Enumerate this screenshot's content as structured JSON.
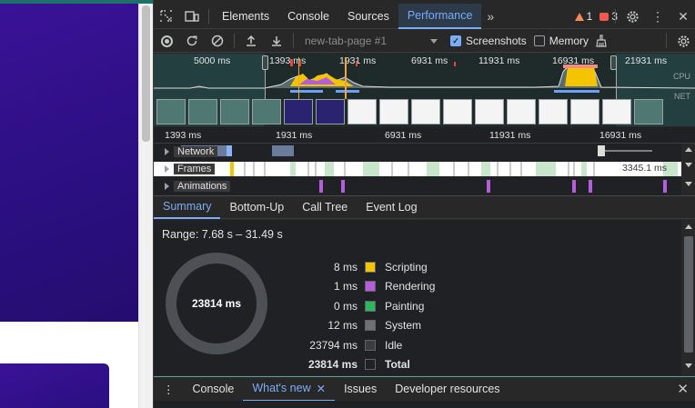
{
  "tabs": {
    "items": [
      "Elements",
      "Console",
      "Sources",
      "Performance"
    ],
    "active": "Performance",
    "warnings_count": "1",
    "errors_count": "3"
  },
  "toolbar": {
    "profile_name": "new-tab-page #1",
    "screenshots_label": "Screenshots",
    "screenshots_checked": true,
    "memory_label": "Memory",
    "memory_checked": false
  },
  "overview": {
    "ticks": [
      "5000 ms",
      "1393 ms",
      "1931 ms",
      "6931 ms",
      "11931 ms",
      "16931 ms",
      "21931 ms"
    ],
    "cpu_label": "CPU",
    "net_label": "NET"
  },
  "timeline": {
    "ticks": [
      "1393 ms",
      "1931 ms",
      "6931 ms",
      "11931 ms",
      "16931 ms"
    ],
    "tracks": [
      {
        "label": "Network"
      },
      {
        "label": "Frames",
        "value": "3345.1 ms"
      },
      {
        "label": "Animations"
      }
    ]
  },
  "bottom_tabs": {
    "items": [
      "Summary",
      "Bottom-Up",
      "Call Tree",
      "Event Log"
    ],
    "active": "Summary"
  },
  "summary": {
    "range": "Range: 7.68 s – 31.49 s",
    "total_ms": "23814 ms",
    "rows": [
      {
        "value": "8 ms",
        "name": "Scripting",
        "color": "#f3c500"
      },
      {
        "value": "1 ms",
        "name": "Rendering",
        "color": "#b45edb"
      },
      {
        "value": "0 ms",
        "name": "Painting",
        "color": "#2fb65f"
      },
      {
        "value": "12 ms",
        "name": "System",
        "color": "#6f7073"
      },
      {
        "value": "23794 ms",
        "name": "Idle",
        "color": "#3a3d40"
      },
      {
        "value": "23814 ms",
        "name": "Total",
        "color": "#202124"
      }
    ]
  },
  "drawer": {
    "items": [
      "Console",
      "What's new",
      "Issues",
      "Developer resources"
    ],
    "active": "What's new"
  },
  "colors": {
    "accent": "#7cacf8",
    "hero": "#2a0f80"
  }
}
